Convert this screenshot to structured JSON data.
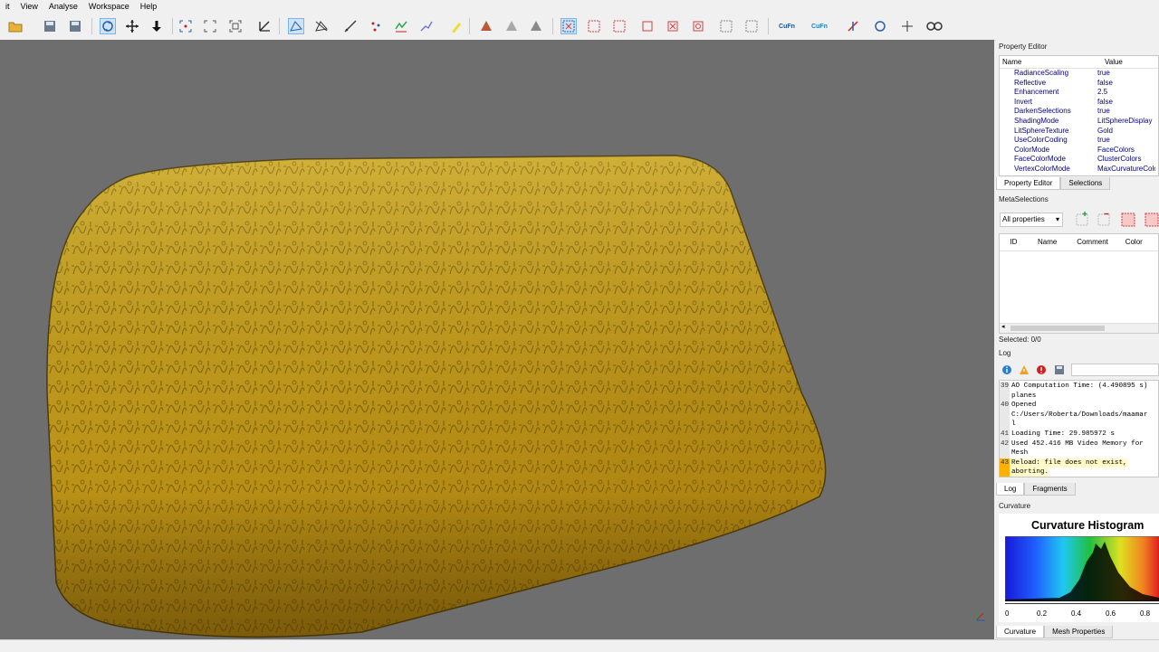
{
  "menu": [
    "it",
    "View",
    "Analyse",
    "Workspace",
    "Help"
  ],
  "property_editor": {
    "title": "Property Editor",
    "col_name": "Name",
    "col_value": "Value",
    "rows": [
      {
        "name": "RadianceScaling",
        "value": "true"
      },
      {
        "name": "Reflective",
        "value": "false"
      },
      {
        "name": "Enhancement",
        "value": "2.5"
      },
      {
        "name": "Invert",
        "value": "false"
      },
      {
        "name": "DarkenSelections",
        "value": "true"
      },
      {
        "name": "ShadingMode",
        "value": "LitSphereDisplay"
      },
      {
        "name": "LitSphereTexture",
        "value": "Gold"
      },
      {
        "name": "UseColorCoding",
        "value": "true"
      },
      {
        "name": "ColorMode",
        "value": "FaceColors"
      },
      {
        "name": "FaceColorMode",
        "value": "ClusterColors"
      },
      {
        "name": "VertexColorMode",
        "value": "MaxCurvatureColors"
      }
    ],
    "tabs": [
      "Property Editor",
      "Selections"
    ]
  },
  "metaselections": {
    "title": "MetaSelections",
    "filter": "All properties",
    "columns": [
      "ID",
      "Name",
      "Comment",
      "Color"
    ],
    "selected": "Selected: 0/0"
  },
  "log": {
    "title": "Log",
    "lines": [
      {
        "num": "39",
        "text": "AO Computation Time: (4.490895 s)",
        "hl": false
      },
      {
        "num": "",
        "text": "planes",
        "hl": false
      },
      {
        "num": "40",
        "text": "Opened",
        "hl": false
      },
      {
        "num": "",
        "text": "C:/Users/Roberta/Downloads/maamar",
        "hl": false
      },
      {
        "num": "",
        "text": "l",
        "hl": false
      },
      {
        "num": "41",
        "text": "Loading Time: 29.985972 s",
        "hl": false
      },
      {
        "num": "42",
        "text": "Used  452.416 MB Video Memory for",
        "hl": false
      },
      {
        "num": "",
        "text": "Mesh",
        "hl": false
      },
      {
        "num": "43",
        "text": "Reload: file does not exist,",
        "hl": true
      },
      {
        "num": "",
        "text": "aborting.",
        "hl": true
      }
    ],
    "tabs": [
      "Log",
      "Fragments"
    ]
  },
  "curvature": {
    "title": "Curvature",
    "histogram_title": "Curvature Histogram",
    "ticks": [
      "0",
      "0.2",
      "0.4",
      "0.6",
      "0.8"
    ],
    "tabs": [
      "Curvature",
      "Mesh Properties"
    ]
  },
  "colors": {
    "viewport_bg": "#6e6e6e",
    "tablet_gold": "#c9a420",
    "log_highlight": "#fffac8"
  }
}
